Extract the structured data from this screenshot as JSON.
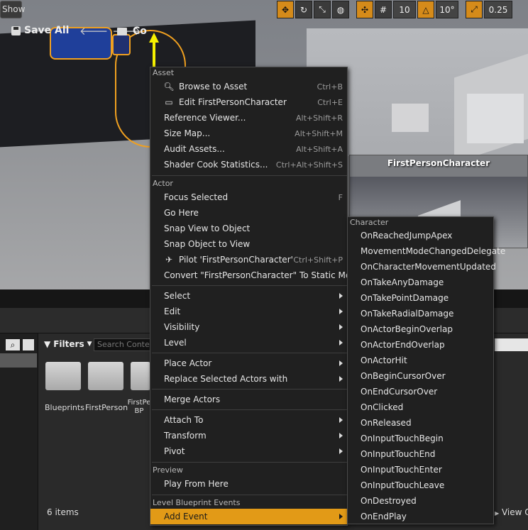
{
  "viewport": {
    "show_label": "Show",
    "toolbar": {
      "grid_snap_value": "10",
      "rotation_snap_value": "10°",
      "scale_snap_value": "0.25"
    },
    "inset_title": "FirstPersonCharacter"
  },
  "content_browser": {
    "save_all_label": "Save All",
    "path_label": "Co",
    "filters_label": "Filters",
    "search_placeholder": "Search Content",
    "assets": [
      {
        "label": "Blueprints"
      },
      {
        "label": "FirstPerson"
      },
      {
        "label": "FirstPe BP"
      }
    ],
    "item_count": "6 items",
    "view_options_label": "View O"
  },
  "context_menu": {
    "sections": {
      "asset": "Asset",
      "actor": "Actor",
      "preview": "Preview",
      "level_blueprint_events": "Level Blueprint Events"
    },
    "items": {
      "browse_to_asset": {
        "label": "Browse to Asset",
        "shortcut": "Ctrl+B"
      },
      "edit_asset": {
        "label": "Edit FirstPersonCharacter",
        "shortcut": "Ctrl+E"
      },
      "reference_viewer": {
        "label": "Reference Viewer...",
        "shortcut": "Alt+Shift+R"
      },
      "size_map": {
        "label": "Size Map...",
        "shortcut": "Alt+Shift+M"
      },
      "audit_assets": {
        "label": "Audit Assets...",
        "shortcut": "Alt+Shift+A"
      },
      "shader_cook": {
        "label": "Shader Cook Statistics...",
        "shortcut": "Ctrl+Alt+Shift+S"
      },
      "focus_selected": {
        "label": "Focus Selected",
        "shortcut": "F"
      },
      "go_here": {
        "label": "Go Here"
      },
      "snap_view": {
        "label": "Snap View to Object"
      },
      "snap_object": {
        "label": "Snap Object to View"
      },
      "pilot": {
        "label": "Pilot 'FirstPersonCharacter'",
        "shortcut": "Ctrl+Shift+P"
      },
      "convert": {
        "label": "Convert \"FirstPersonCharacter\" To Static Mesh"
      },
      "select": {
        "label": "Select"
      },
      "edit": {
        "label": "Edit"
      },
      "visibility": {
        "label": "Visibility"
      },
      "level": {
        "label": "Level"
      },
      "place_actor": {
        "label": "Place Actor"
      },
      "replace_selected": {
        "label": "Replace Selected Actors with"
      },
      "merge_actors": {
        "label": "Merge Actors"
      },
      "attach_to": {
        "label": "Attach To"
      },
      "transform": {
        "label": "Transform"
      },
      "pivot": {
        "label": "Pivot"
      },
      "play_from_here": {
        "label": "Play From Here"
      },
      "add_event": {
        "label": "Add Event"
      }
    }
  },
  "submenu": {
    "section": "Character",
    "items": [
      "OnReachedJumpApex",
      "MovementModeChangedDelegate",
      "OnCharacterMovementUpdated",
      "OnTakeAnyDamage",
      "OnTakePointDamage",
      "OnTakeRadialDamage",
      "OnActorBeginOverlap",
      "OnActorEndOverlap",
      "OnActorHit",
      "OnBeginCursorOver",
      "OnEndCursorOver",
      "OnClicked",
      "OnReleased",
      "OnInputTouchBegin",
      "OnInputTouchEnd",
      "OnInputTouchEnter",
      "OnInputTouchLeave",
      "OnDestroyed",
      "OnEndPlay"
    ]
  },
  "colors": {
    "highlight": "#e29a17",
    "selection_outline": "#f0a020",
    "menu_bg": "#202020"
  }
}
